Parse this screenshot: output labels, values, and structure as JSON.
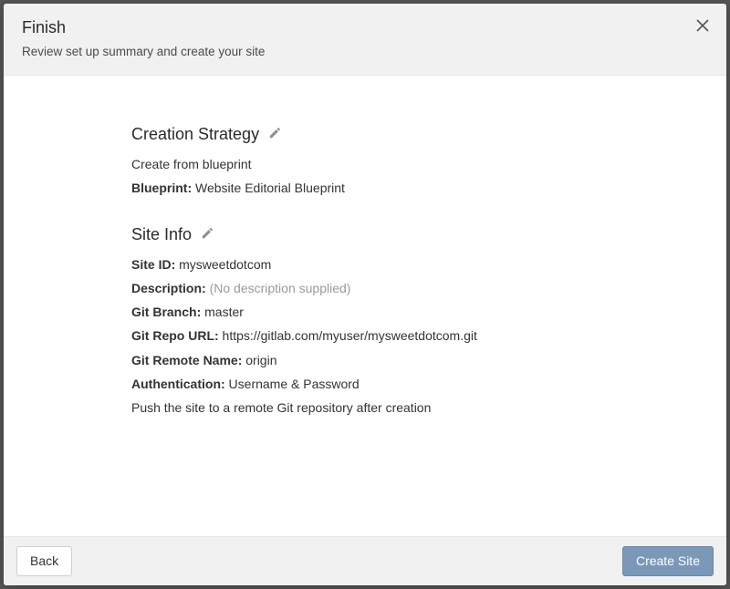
{
  "header": {
    "title": "Finish",
    "subtitle": "Review set up summary and create your site"
  },
  "sections": {
    "strategy": {
      "title": "Creation Strategy",
      "create_from": "Create from blueprint",
      "blueprint_label": "Blueprint:",
      "blueprint_value": "Website Editorial Blueprint"
    },
    "siteinfo": {
      "title": "Site Info",
      "site_id_label": "Site ID:",
      "site_id_value": "mysweetdotcom",
      "description_label": "Description:",
      "description_value": "(No description supplied)",
      "git_branch_label": "Git Branch:",
      "git_branch_value": "master",
      "git_repo_label": "Git Repo URL:",
      "git_repo_value": "https://gitlab.com/myuser/mysweetdotcom.git",
      "git_remote_label": "Git Remote Name:",
      "git_remote_value": "origin",
      "auth_label": "Authentication:",
      "auth_value": "Username & Password",
      "push_note": "Push the site to a remote Git repository after creation"
    }
  },
  "footer": {
    "back_label": "Back",
    "create_label": "Create Site"
  }
}
